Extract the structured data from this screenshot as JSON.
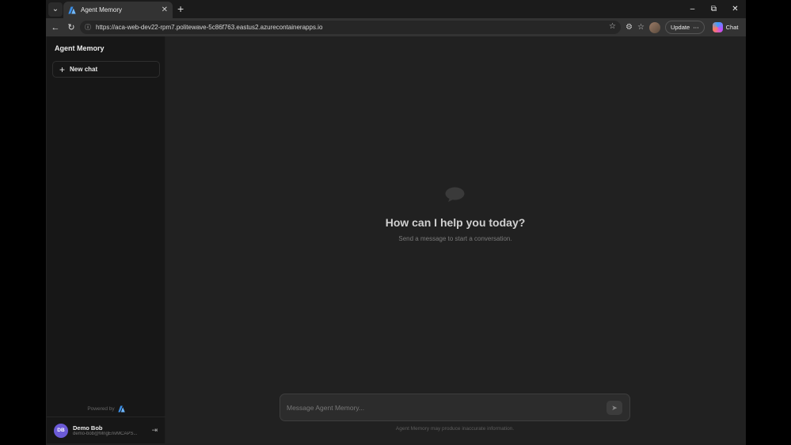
{
  "browser": {
    "tab": {
      "title": "Agent Memory",
      "close_glyph": "✕"
    },
    "tab_list_glyph": "⌄",
    "new_tab_glyph": "+",
    "window_controls": {
      "minimize": "–",
      "restore": "⧉",
      "close": "✕"
    },
    "nav": {
      "back": "←",
      "refresh": "↻"
    },
    "address": {
      "url": "https://aca-web-dev22-rpm7.politewave-5c86f763.eastus2.azurecontainerapps.io",
      "lock_glyph": "ⓘ",
      "star_glyph": "☆"
    },
    "toolbar_icons": {
      "extensions": "⚙",
      "favorites": "☆"
    },
    "update_button": {
      "label": "Update",
      "more_glyph": "⋯"
    },
    "chat_button": {
      "label": "Chat"
    }
  },
  "sidebar": {
    "title": "Agent Memory",
    "new_chat": {
      "icon": "+",
      "label": "New chat"
    },
    "powered_by": "Powered by",
    "user": {
      "initials": "DB",
      "name": "Demo Bob",
      "email": "demo-bob@MngEnvMCAPS...",
      "logout_glyph": "⇥"
    }
  },
  "main": {
    "headline": "How can I help you today?",
    "subline": "Send a message to start a conversation.",
    "composer": {
      "placeholder": "Message Agent Memory...",
      "send_glyph": "➤"
    },
    "disclaimer": "Agent Memory may produce inaccurate information."
  },
  "colors": {
    "avatar": "#6b5ad6",
    "azure_blue": "#3a8ee6",
    "background": "#212121",
    "sidebar": "#171717"
  },
  "icons": [
    "chevron-down-icon",
    "azure-logo-icon",
    "close-icon",
    "plus-icon",
    "back-icon",
    "refresh-icon",
    "info-icon",
    "star-icon",
    "extensions-icon",
    "favorites-icon",
    "profile-icon",
    "copilot-icon",
    "chat-bubble-icon",
    "send-icon",
    "logout-icon"
  ]
}
